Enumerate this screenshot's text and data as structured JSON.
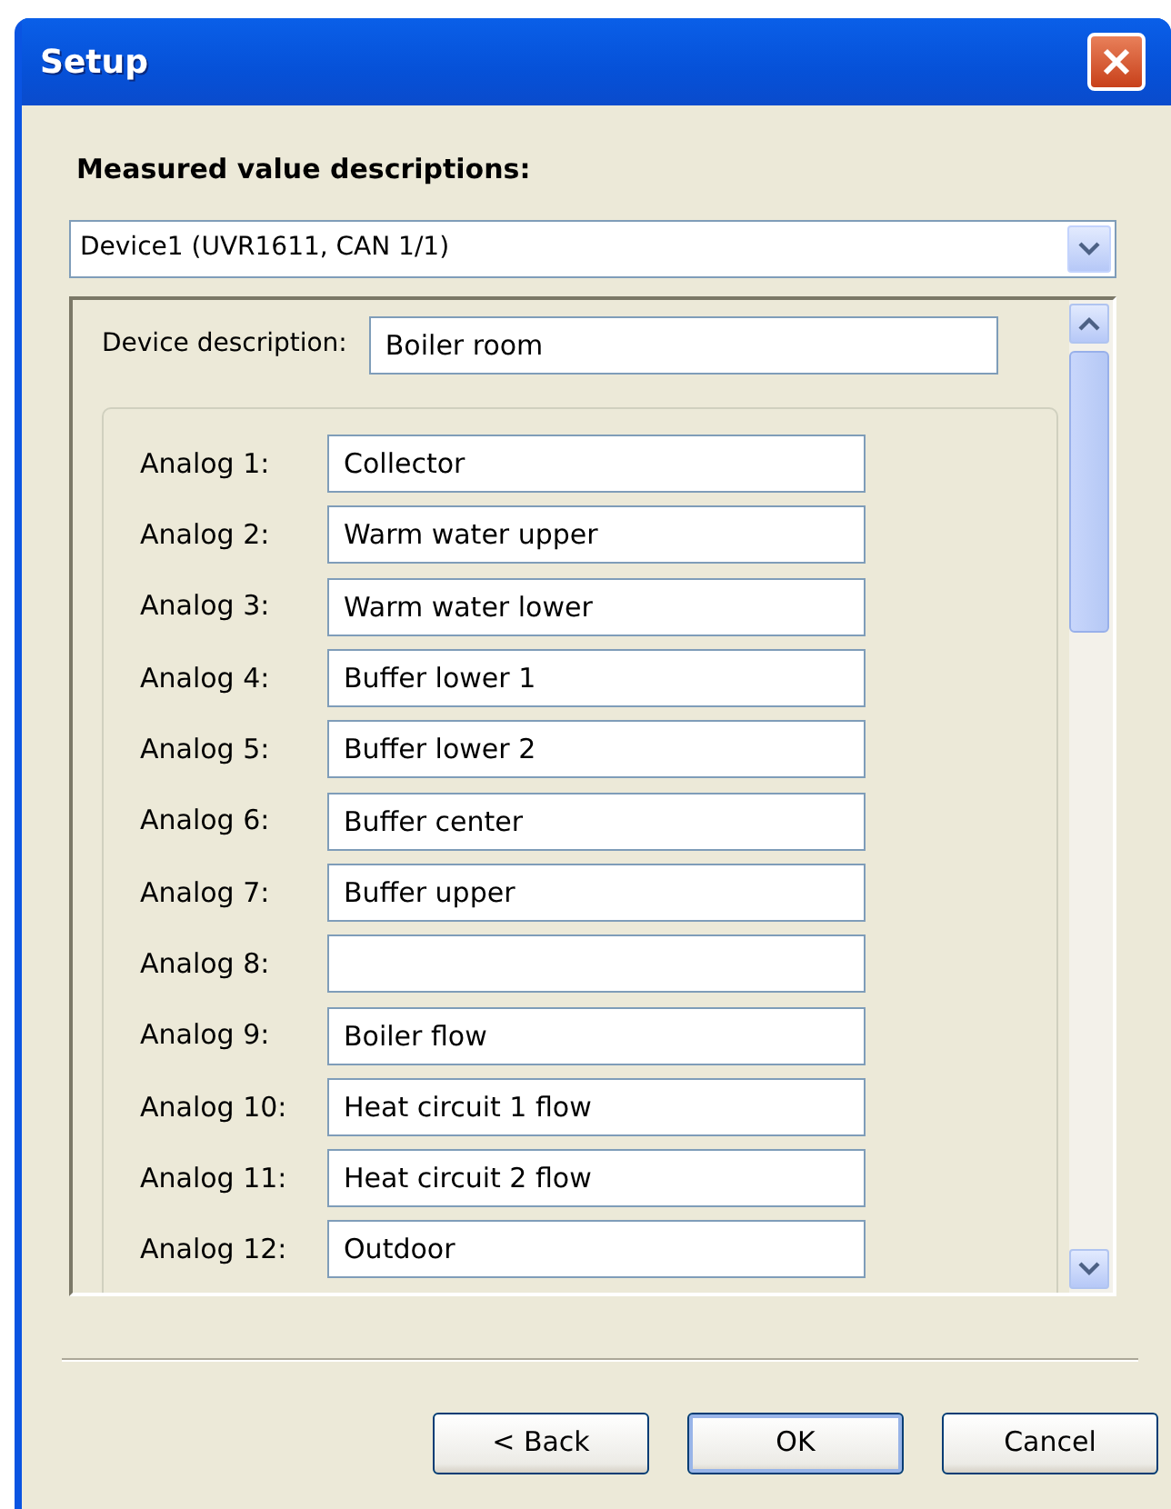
{
  "window": {
    "title": "Setup"
  },
  "heading": "Measured value descriptions:",
  "device_select": {
    "value": "Device1 (UVR1611, CAN 1/1)"
  },
  "device_description": {
    "label": "Device description:",
    "value": "Boiler room"
  },
  "analog_fields": [
    {
      "label": "Analog 1:",
      "value": "Collector"
    },
    {
      "label": "Analog 2:",
      "value": "Warm water upper"
    },
    {
      "label": "Analog 3:",
      "value": "Warm water lower"
    },
    {
      "label": "Analog 4:",
      "value": "Buffer lower 1"
    },
    {
      "label": "Analog 5:",
      "value": "Buffer lower 2"
    },
    {
      "label": "Analog 6:",
      "value": "Buffer center"
    },
    {
      "label": "Analog 7:",
      "value": "Buffer upper"
    },
    {
      "label": "Analog 8:"
    },
    {
      "label": "Analog 9:",
      "value": "Boiler flow"
    },
    {
      "label": "Analog 10:",
      "value": "Heat circuit 1 flow"
    },
    {
      "label": "Analog 11:",
      "value": "Heat circuit 2 flow"
    },
    {
      "label": "Analog 12:",
      "value": "Outdoor"
    }
  ],
  "buttons": [
    {
      "label": "< Back",
      "default": false
    },
    {
      "label": "OK",
      "default": true
    },
    {
      "label": "Cancel",
      "default": false
    }
  ]
}
